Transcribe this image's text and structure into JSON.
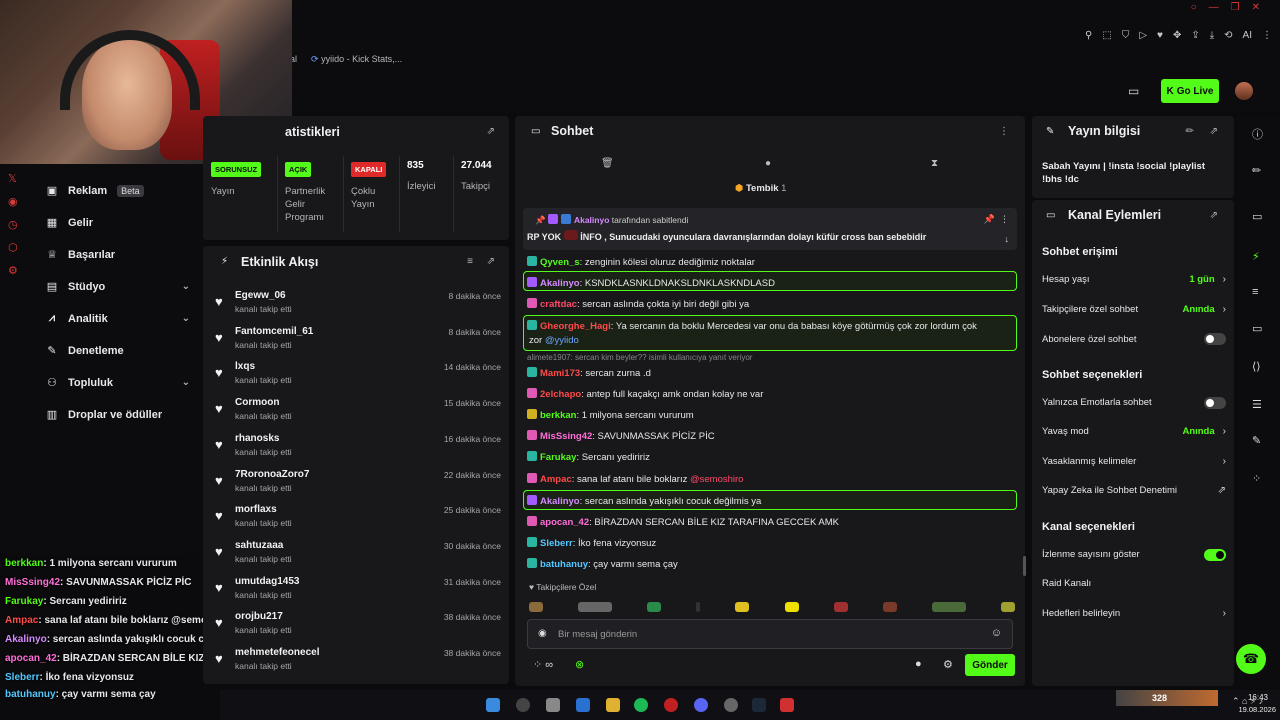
{
  "browser": {
    "tabs": [
      {
        "label": "al"
      },
      {
        "label": "yyiido - Kick Stats,..."
      }
    ],
    "go_live": "Go Live",
    "profile_initials": "AI"
  },
  "left_nav": {
    "items": [
      {
        "label": "Reklam",
        "badge": "Beta",
        "icon": "megaphone-icon"
      },
      {
        "label": "Gelir",
        "icon": "income-icon"
      },
      {
        "label": "Başarılar",
        "icon": "trophy-icon"
      },
      {
        "label": "Stüdyo",
        "icon": "studio-icon",
        "expandable": true
      },
      {
        "label": "Analitik",
        "icon": "chart-icon",
        "expandable": true
      },
      {
        "label": "Denetleme",
        "icon": "wrench-icon"
      },
      {
        "label": "Topluluk",
        "icon": "people-icon",
        "expandable": true
      },
      {
        "label": "Droplar ve ödüller",
        "icon": "gift-icon"
      }
    ]
  },
  "overlay_chat": [
    {
      "user": "berkkan",
      "msg": ": 1 milyona sercanı vururum",
      "color": "#53fc18"
    },
    {
      "user": "MisSsing42",
      "msg": ": SAVUNMASSAK PİCİZ PİC",
      "color": "#ff6fd8"
    },
    {
      "user": "Farukay",
      "msg": ": Sercanı yediririz",
      "color": "#53fc18"
    },
    {
      "user": "Ampac",
      "msg": ": sana laf atanı bile boklarız @semoshi",
      "color": "#ff4a4a"
    },
    {
      "user": "Akalinyo",
      "msg": ": sercan aslında yakışıklı cocuk c",
      "color": "#d58aff"
    },
    {
      "user": "apocan_42",
      "msg": ": BİRAZDAN SERCAN BİLE KIZ TAR",
      "color": "#ff6fd8"
    },
    {
      "user": "Sleberr",
      "msg": ": İko fena vizyonsuz",
      "color": "#53c8ff"
    },
    {
      "user": "batuhanuy",
      "msg": ": çay varmı sema çay",
      "color": "#53c8ff"
    }
  ],
  "stats": {
    "title": "atistikleri",
    "cols": [
      {
        "badge": "SORUNSUZ",
        "badge_color": "#53fc18",
        "label": "Yayın"
      },
      {
        "badge": "AÇIK",
        "badge_color": "#53fc18",
        "label": "Partnerlik Gelir Programı"
      },
      {
        "badge": "KAPALI",
        "badge_color": "#e02a2a",
        "label": "Çoklu Yayın"
      },
      {
        "value": "835",
        "label": "İzleyici"
      },
      {
        "value": "27.044",
        "label": "Takipçi"
      }
    ]
  },
  "activity": {
    "title": "Etkinlik Akışı",
    "items": [
      {
        "name": "Egeww_06",
        "sub": "kanalı takip etti",
        "time": "8 dakika önce"
      },
      {
        "name": "Fantomcemil_61",
        "sub": "kanalı takip etti",
        "time": "8 dakika önce"
      },
      {
        "name": "lxqs",
        "sub": "kanalı takip etti",
        "time": "14 dakika önce"
      },
      {
        "name": "Cormoon",
        "sub": "kanalı takip etti",
        "time": "15 dakika önce"
      },
      {
        "name": "rhanosks",
        "sub": "kanalı takip etti",
        "time": "16 dakika önce"
      },
      {
        "name": "7RoronoaZoro7",
        "sub": "kanalı takip etti",
        "time": "22 dakika önce"
      },
      {
        "name": "morflaxs",
        "sub": "kanalı takip etti",
        "time": "25 dakika önce"
      },
      {
        "name": "sahtuzaaa",
        "sub": "kanalı takip etti",
        "time": "30 dakika önce"
      },
      {
        "name": "umutdag1453",
        "sub": "kanalı takip etti",
        "time": "31 dakika önce"
      },
      {
        "name": "orojbu217",
        "sub": "kanalı takip etti",
        "time": "38 dakika önce"
      },
      {
        "name": "mehmetefeonecel",
        "sub": "kanalı takip etti",
        "time": "38 dakika önce"
      }
    ]
  },
  "chat": {
    "title": "Sohbet",
    "tembik": "Tembik",
    "tembik_count": "1",
    "pinned_by_user": "Akalinyo",
    "pinned_by_suffix": "tarafından sabitlendi",
    "pinned_msg_prefix": "RP YOK",
    "pinned_msg": "İNFO , Sunucudaki oyunculara davranışlarından dolayı küfür cross ban sebebidir",
    "reply_note": "alimete1907: sercan kim beyler?? isimli kullanıcıya yanıt veriyor",
    "messages": [
      {
        "user": "Qyven_s",
        "msg": ": zenginin kölesi oluruz dediğimiz noktalar",
        "color": "#53fc18"
      },
      {
        "user": "Akalinyo",
        "msg": ": KSNDKLASNKLDNAKSLDNKLASKNDLASD",
        "color": "#d58aff"
      },
      {
        "user": "craftdac",
        "msg": ": sercan aslında çokta iyi biri değil gibi ya",
        "color": "#ff4a6a"
      },
      {
        "user": "Gheorghe_Hagi",
        "msg": ": Ya sercanın da boklu Mercedesi var onu da babası köye götürmüş çok zor lordum çok",
        "color": "#ff4a4a"
      },
      {
        "user": "",
        "msg": "zor",
        "mention": "@yyiido"
      },
      {
        "user": "Mami173",
        "msg": ": sercan zurna .d",
        "color": "#ff4a4a"
      },
      {
        "user": "2elchapo",
        "msg": ": antep full kaçakçı amk ondan kolay ne var",
        "color": "#ff4a4a"
      },
      {
        "user": "berkkan",
        "msg": ": 1 milyona sercanı vururum",
        "color": "#53fc18"
      },
      {
        "user": "MisSsing42",
        "msg": ": SAVUNMASSAK PİCİZ PİC",
        "color": "#ff6fd8"
      },
      {
        "user": "Farukay",
        "msg": ": Sercanı yediririz",
        "color": "#53fc18"
      },
      {
        "user": "Ampac",
        "msg": ": sana laf atanı bile boklarız",
        "color": "#ff4a4a",
        "mention": "@semoshiro"
      },
      {
        "user": "Akalinyo",
        "msg": ": sercan aslında yakışıklı cocuk değilmis ya",
        "color": "#d58aff"
      },
      {
        "user": "apocan_42",
        "msg": ": BİRAZDAN SERCAN BİLE KIZ TARAFINA GECCEK AMK",
        "color": "#ff6fd8"
      },
      {
        "user": "Sleberr",
        "msg": ": İko fena vizyonsuz",
        "color": "#53c8ff"
      },
      {
        "user": "batuhanuy",
        "msg": ": çay varmı sema çay",
        "color": "#53c8ff"
      }
    ],
    "followers_only": "Takipçilere Özel",
    "input_placeholder": "Bir mesaj gönderin",
    "send": "Gönder"
  },
  "stream_info": {
    "title": "Yayın bilgisi",
    "text": "Sabah Yayını | !insta !social !playlist !bhs !dc"
  },
  "channel_actions": {
    "title": "Kanal Eylemleri",
    "sections": [
      {
        "heading": "Sohbet erişimi",
        "items": [
          {
            "label": "Hesap yaşı",
            "value": "1 gün",
            "kind": "arrow"
          },
          {
            "label": "Takipçilere özel sohbet",
            "value": "Anında",
            "kind": "arrow"
          },
          {
            "label": "Abonelere özel sohbet",
            "kind": "toggle",
            "on": false
          }
        ]
      },
      {
        "heading": "Sohbet seçenekleri",
        "items": [
          {
            "label": "Yalnızca Emotlarla sohbet",
            "kind": "toggle",
            "on": false
          },
          {
            "label": "Yavaş mod",
            "value": "Anında",
            "kind": "arrow"
          },
          {
            "label": "Yasaklanmış kelimeler",
            "kind": "arrow"
          },
          {
            "label": "Yapay Zeka ile Sohbet Denetimi",
            "kind": "external"
          }
        ]
      },
      {
        "heading": "Kanal seçenekleri",
        "items": [
          {
            "label": "İzlenme sayısını göster",
            "kind": "toggle",
            "on": true
          },
          {
            "label": "Raid Kanalı",
            "kind": "none"
          },
          {
            "label": "Hedefleri belirleyin",
            "kind": "arrow"
          }
        ]
      }
    ]
  },
  "taskbar": {
    "temp": "328",
    "time": "16:43",
    "date": "19.08.2026"
  },
  "colors": {
    "accent": "#53fc18",
    "panel": "#18181b",
    "bg": "#0b0b0d"
  }
}
